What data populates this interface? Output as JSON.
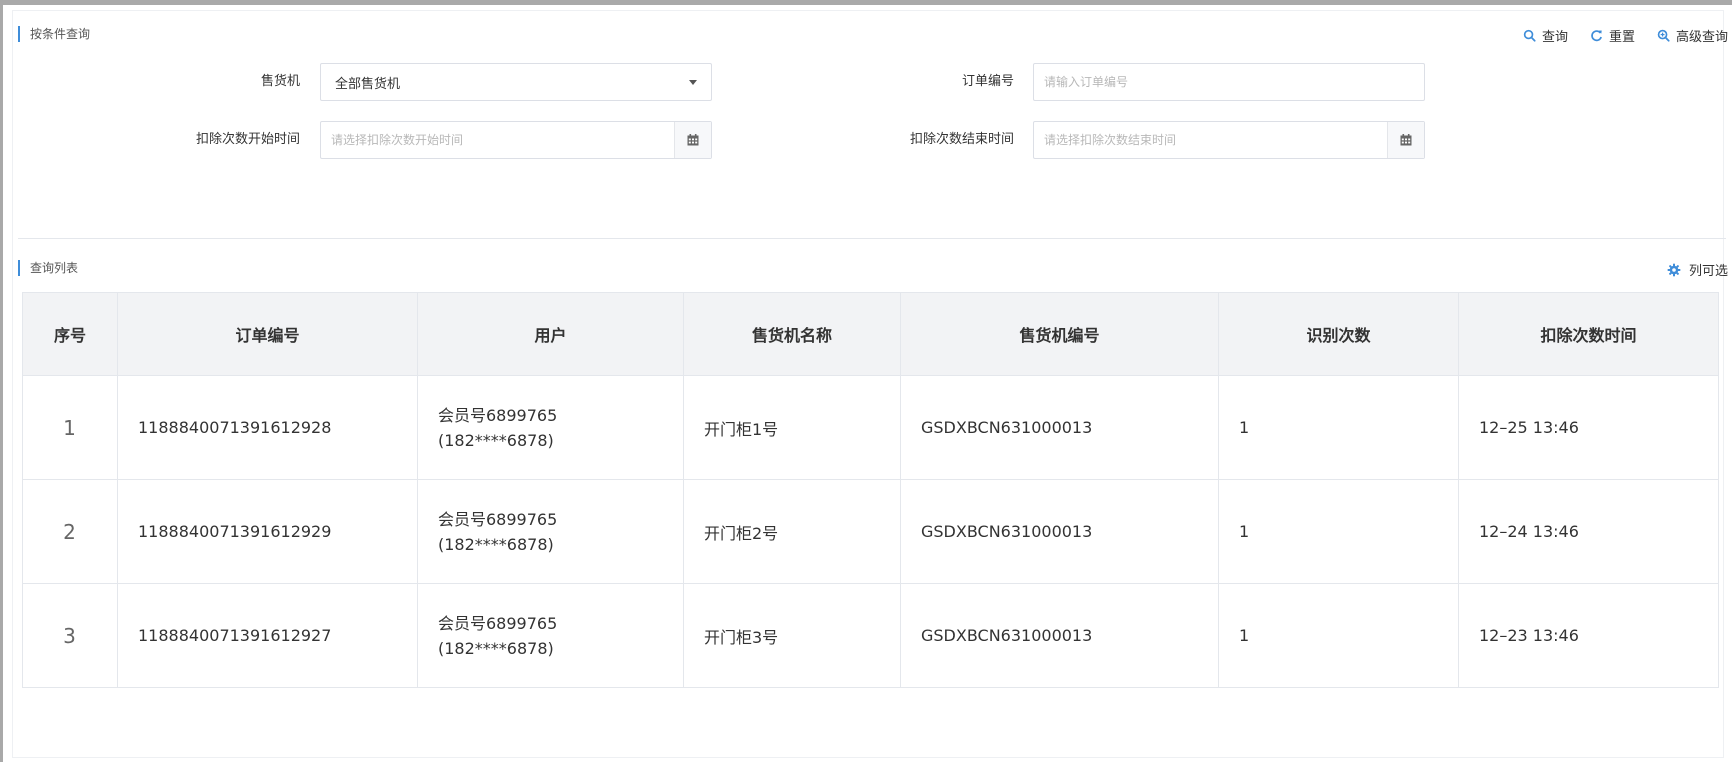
{
  "search": {
    "section_title": "按条件查询",
    "actions": {
      "query": "查询",
      "reset": "重置",
      "advanced": "高级查询"
    },
    "vending_machine": {
      "label": "售货机",
      "value": "全部售货机"
    },
    "order_no": {
      "label": "订单编号",
      "placeholder": "请输入订单编号"
    },
    "start_time": {
      "label": "扣除次数开始时间",
      "placeholder": "请选择扣除次数开始时间"
    },
    "end_time": {
      "label": "扣除次数结束时间",
      "placeholder": "请选择扣除次数结束时间"
    }
  },
  "list": {
    "section_title": "查询列表",
    "column_picker": "列可选",
    "columns": [
      "序号",
      "订单编号",
      "用户",
      "售货机名称",
      "售货机编号",
      "识别次数",
      "扣除次数时间"
    ],
    "rows": [
      {
        "index": "1",
        "order_no": "1188840071391612928",
        "user_line1": "会员号6899765",
        "user_line2": "(182****6878)",
        "machine_name": "开门柜1号",
        "machine_no": "GSDXBCN631000013",
        "recognition_count": "1",
        "deduct_time": "12–25 13:46"
      },
      {
        "index": "2",
        "order_no": "1188840071391612929",
        "user_line1": "会员号6899765",
        "user_line2": "(182****6878)",
        "machine_name": "开门柜2号",
        "machine_no": "GSDXBCN631000013",
        "recognition_count": "1",
        "deduct_time": "12–24 13:46"
      },
      {
        "index": "3",
        "order_no": "1188840071391612927",
        "user_line1": "会员号6899765",
        "user_line2": "(182****6878)",
        "machine_name": "开门柜3号",
        "machine_no": "GSDXBCN631000013",
        "recognition_count": "1",
        "deduct_time": "12–23 13:46"
      }
    ]
  },
  "colors": {
    "accent": "#3f8dd9",
    "header_bg": "#f2f3f5",
    "border": "#e4e7ec"
  },
  "icons": {
    "query": "search-icon",
    "reset": "refresh-icon",
    "advanced": "zoom-search-icon",
    "calendar": "calendar-icon",
    "column_picker": "gear-icon"
  }
}
